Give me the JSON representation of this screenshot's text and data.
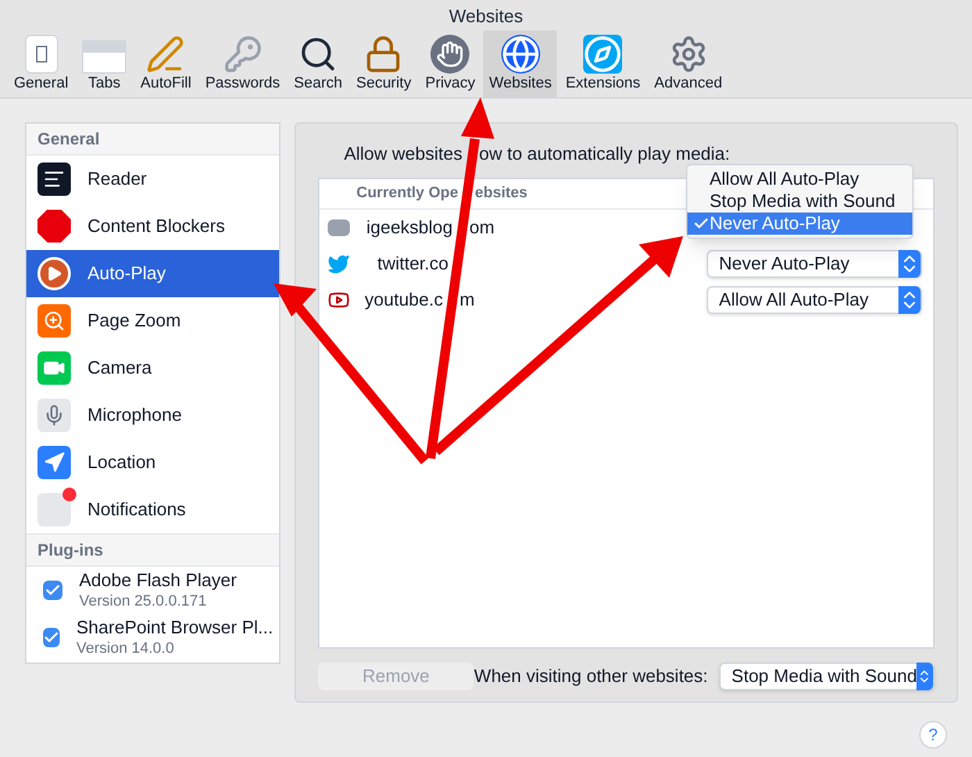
{
  "window": {
    "title": "Websites"
  },
  "toolbar": [
    {
      "label": "General",
      "selected": false
    },
    {
      "label": "Tabs",
      "selected": false
    },
    {
      "label": "AutoFill",
      "selected": false
    },
    {
      "label": "Passwords",
      "selected": false
    },
    {
      "label": "Search",
      "selected": false
    },
    {
      "label": "Security",
      "selected": false
    },
    {
      "label": "Privacy",
      "selected": false
    },
    {
      "label": "Websites",
      "selected": true
    },
    {
      "label": "Extensions",
      "selected": false
    },
    {
      "label": "Advanced",
      "selected": false
    }
  ],
  "sidebar": {
    "general_title": "General",
    "general": [
      {
        "label": "Reader",
        "selected": false
      },
      {
        "label": "Content Blockers",
        "selected": false
      },
      {
        "label": "Auto-Play",
        "selected": true
      },
      {
        "label": "Page Zoom",
        "selected": false
      },
      {
        "label": "Camera",
        "selected": false
      },
      {
        "label": "Microphone",
        "selected": false
      },
      {
        "label": "Location",
        "selected": false
      },
      {
        "label": "Notifications",
        "selected": false
      }
    ],
    "plugins_title": "Plug-ins",
    "plugins": [
      {
        "name": "Adobe Flash Player",
        "version": "Version 25.0.0.171",
        "checked": true
      },
      {
        "name": "SharePoint Browser Pl...",
        "version": "Version 14.0.0",
        "checked": true
      }
    ]
  },
  "panel": {
    "prompt": [
      "Allow websites",
      "ow to automatically play media:"
    ],
    "table_header": [
      "Currently Ope",
      "ebsites"
    ],
    "rows": [
      {
        "site": [
          "igeeksblog",
          "om"
        ]
      },
      {
        "site": [
          "twitter.co"
        ],
        "setting": "Never Auto-Play"
      },
      {
        "site": [
          "youtube.c",
          "m"
        ],
        "setting": "Allow All Auto-Play"
      }
    ],
    "menu": [
      {
        "label": "Allow All Auto-Play",
        "selected": false
      },
      {
        "label": "Stop Media with Sound",
        "selected": false
      },
      {
        "label": "Never Auto-Play",
        "selected": true
      }
    ],
    "remove_button": {
      "label": "Remove",
      "disabled": true
    },
    "other_label": "When visiting other websites:",
    "other_setting": "Stop Media with Sound"
  },
  "help": "?"
}
